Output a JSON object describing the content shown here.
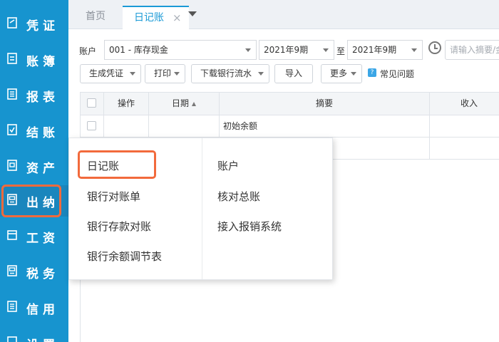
{
  "sidebar": {
    "items": [
      {
        "label": "凭证",
        "icon": "voucher-icon"
      },
      {
        "label": "账簿",
        "icon": "ledger-icon"
      },
      {
        "label": "报表",
        "icon": "report-icon"
      },
      {
        "label": "结账",
        "icon": "checkout-icon"
      },
      {
        "label": "资产",
        "icon": "asset-icon"
      },
      {
        "label": "出纳",
        "icon": "cashier-icon"
      },
      {
        "label": "工资",
        "icon": "salary-icon"
      },
      {
        "label": "税务",
        "icon": "tax-icon"
      },
      {
        "label": "信用",
        "icon": "credit-icon"
      },
      {
        "label": "设置",
        "icon": "settings-icon"
      }
    ]
  },
  "tabs": {
    "home": "首页",
    "active": "日记账",
    "close": "×"
  },
  "filters": {
    "account_label": "账户",
    "account_value": "001 - 库存现金",
    "period_from": "2021年9期",
    "to_label": "至",
    "period_to": "2021年9期",
    "search_placeholder": "请输入摘要/金"
  },
  "toolbar": {
    "generate_voucher": "生成凭证",
    "print": "打印",
    "download_bank": "下载银行流水",
    "import": "导入",
    "more": "更多",
    "faq": "常见问题"
  },
  "table": {
    "headers": [
      "操作",
      "日期",
      "摘要",
      "收入"
    ],
    "rows": [
      {
        "summary": "初始余额"
      }
    ]
  },
  "menu": {
    "left": [
      "日记账",
      "银行对账单",
      "银行存款对账",
      "银行余额调节表"
    ],
    "right": [
      "账户",
      "核对总账",
      "接入报销系统"
    ]
  },
  "colors": {
    "sidebar": "#1794cf",
    "accent": "#1a9ad6",
    "highlight": "#f26a3c"
  }
}
